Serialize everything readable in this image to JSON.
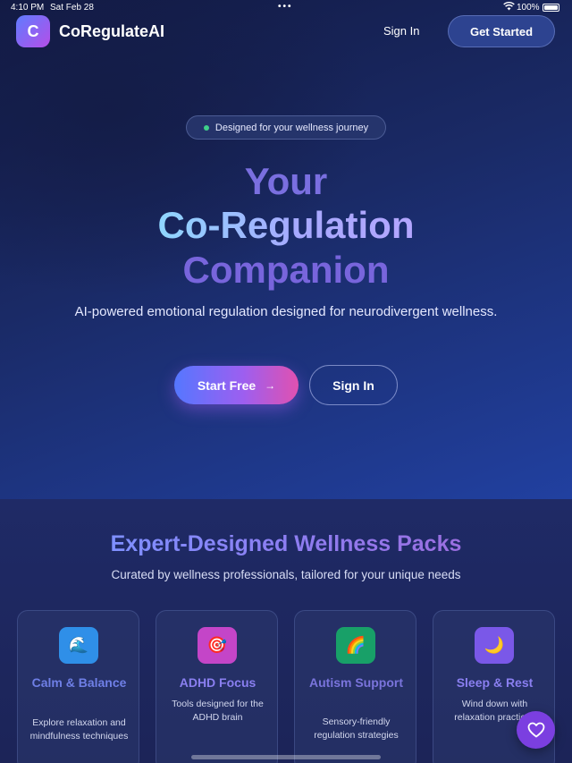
{
  "status_bar": {
    "time": "4:10 PM",
    "date": "Sat Feb 28",
    "battery": "100%"
  },
  "nav": {
    "logo_letter": "C",
    "brand": "CoRegulateAI",
    "signin_label": "Sign In",
    "cta_label": "Get Started"
  },
  "hero": {
    "badge": "Designed for your wellness journey",
    "title_line1": "Your",
    "title_line2": "Co-Regulation",
    "title_line3": "Companion",
    "lead": "AI-powered emotional regulation designed for neurodivergent wellness.",
    "start_label": "Start Free",
    "start_arrow": "→",
    "signin_label": "Sign In"
  },
  "packs": {
    "title": "Expert-Designed Wellness Packs",
    "subtitle": "Curated by wellness professionals, tailored for your unique needs",
    "items": [
      {
        "icon": "wave-icon",
        "glyph": "🌊",
        "title": "Calm & Balance",
        "desc": "Explore relaxation and mindfulness techniques",
        "color": "#2f8fe8",
        "title_color": "#6f7fe6"
      },
      {
        "icon": "target-icon",
        "glyph": "🎯",
        "title": "ADHD Focus",
        "desc": "Tools designed for the ADHD brain",
        "color": "#c445c8",
        "title_color": "#8a7ff0"
      },
      {
        "icon": "rainbow-icon",
        "glyph": "🌈",
        "title": "Autism Support",
        "desc": "Sensory-friendly regulation strategies",
        "color": "#18a068",
        "title_color": "#7a74dc"
      },
      {
        "icon": "moon-icon",
        "glyph": "🌙",
        "title": "Sleep & Rest",
        "desc": "Wind down with relaxation practices",
        "color": "#7a58e8",
        "title_color": "#8a7ff0"
      }
    ]
  },
  "colors": {
    "accent": "#7b3fe0",
    "badge_dot": "#3fd08a"
  }
}
